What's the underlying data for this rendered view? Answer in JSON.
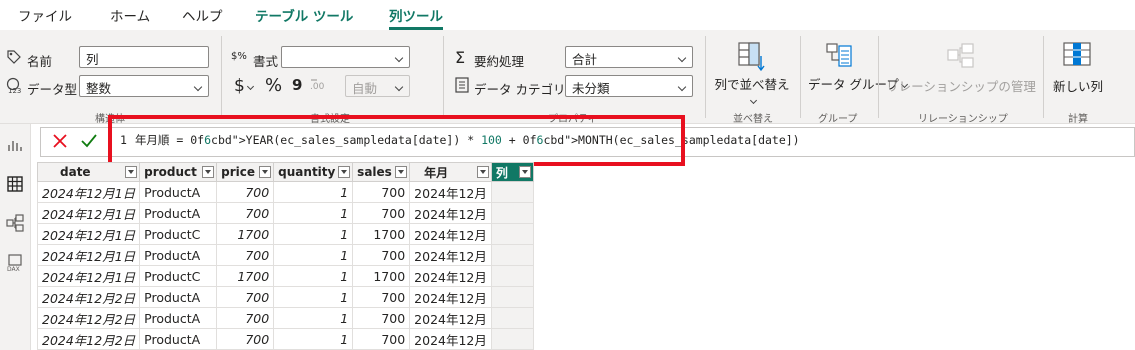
{
  "tabs": [
    "ファイル",
    "ホーム",
    "ヘルプ",
    "テーブル ツール",
    "列ツール"
  ],
  "ribbon": {
    "structure": {
      "name_label": "名前",
      "name_value": "列",
      "datatype_label": "データ型",
      "datatype_value": "整数",
      "group_label": "構造体"
    },
    "format": {
      "format_label": "書式",
      "format_value": "",
      "currency_symbol": "$",
      "percent_symbol": "%",
      "comma_symbol": "9",
      "decimal_value": "自動",
      "group_label": "書式設定"
    },
    "properties": {
      "summarize_label": "要約処理",
      "summarize_value": "合計",
      "category_label": "データ カテゴリ",
      "category_value": "未分類",
      "group_label": "プロパティ"
    },
    "sort": {
      "button_label": "列で並べ替え",
      "group_label": "並べ替え"
    },
    "groups": {
      "button_label": "データ グループ",
      "group_label": "グループ"
    },
    "relationships": {
      "button_label": "リレーションシップの管理",
      "group_label": "リレーションシップ"
    },
    "calculations": {
      "button_label": "新しい列",
      "group_label": "計算"
    }
  },
  "formula": {
    "line_number": "1",
    "text": "年月順 = YEAR(ec_sales_sampledata[date]) * 100 + MONTH(ec_sales_sampledata[date])"
  },
  "table": {
    "columns": [
      "date",
      "product",
      "price",
      "quantity",
      "sales",
      "年月",
      "列"
    ],
    "rows": [
      [
        "2024年12月1日",
        "ProductA",
        "700",
        "1",
        "700",
        "2024年12月"
      ],
      [
        "2024年12月1日",
        "ProductA",
        "700",
        "1",
        "700",
        "2024年12月"
      ],
      [
        "2024年12月1日",
        "ProductC",
        "1700",
        "1",
        "1700",
        "2024年12月"
      ],
      [
        "2024年12月1日",
        "ProductA",
        "700",
        "1",
        "700",
        "2024年12月"
      ],
      [
        "2024年12月1日",
        "ProductC",
        "1700",
        "1",
        "1700",
        "2024年12月"
      ],
      [
        "2024年12月2日",
        "ProductA",
        "700",
        "1",
        "700",
        "2024年12月"
      ],
      [
        "2024年12月2日",
        "ProductA",
        "700",
        "1",
        "700",
        "2024年12月"
      ],
      [
        "2024年12月2日",
        "ProductA",
        "700",
        "1",
        "700",
        "2024年12月"
      ]
    ]
  },
  "colors": {
    "accent": "#117865",
    "highlight": "#e8101f"
  }
}
